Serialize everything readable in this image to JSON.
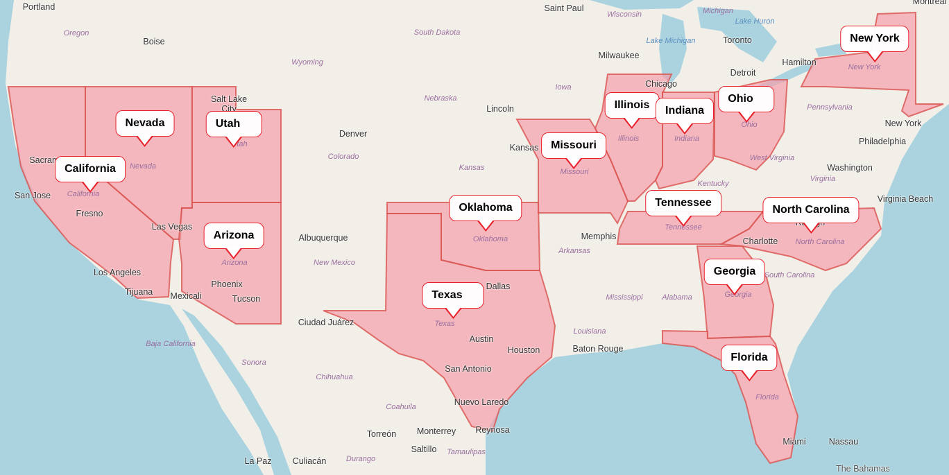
{
  "map": {
    "colors": {
      "land": "#f2efe9",
      "water": "#aad3df",
      "state_fill": "#f4a0aa",
      "state_stroke": "#d9534f",
      "marker_border": "#e8202a"
    },
    "highlighted_states": [
      {
        "name": "New York"
      },
      {
        "name": "California"
      },
      {
        "name": "Nevada"
      },
      {
        "name": "Utah"
      },
      {
        "name": "Arizona"
      },
      {
        "name": "Oklahoma"
      },
      {
        "name": "Texas"
      },
      {
        "name": "Missouri"
      },
      {
        "name": "Illinois"
      },
      {
        "name": "Indiana"
      },
      {
        "name": "Ohio"
      },
      {
        "name": "Tennessee"
      },
      {
        "name": "North Carolina"
      },
      {
        "name": "Georgia"
      },
      {
        "name": "Florida"
      }
    ],
    "cities": [
      "Portland",
      "Boise",
      "Saint Paul",
      "Milwaukee",
      "Toronto",
      "Hamilton",
      "Detroit",
      "Chicago",
      "Salt Lake City",
      "Denver",
      "Lincoln",
      "Kansas City",
      "Sacramento",
      "San Jose",
      "Fresno",
      "Las Vegas",
      "Los Angeles",
      "Tijuana",
      "Mexicali",
      "Phoenix",
      "Tucson",
      "Albuquerque",
      "Ciudad Juárez",
      "Dallas",
      "Austin",
      "Houston",
      "San Antonio",
      "Nuevo Laredo",
      "Reynosa",
      "Memphis",
      "Charlotte",
      "Baton Rouge",
      "New York",
      "Philadelphia",
      "Washington",
      "Virginia Beach",
      "Miami",
      "Nassau",
      "Torreón",
      "Monterrey",
      "Saltillo",
      "Culiacán",
      "La Paz",
      "Montreal",
      "Raleigh"
    ],
    "regions": [
      "Oregon",
      "Wyoming",
      "South Dakota",
      "Nebraska",
      "Iowa",
      "Wisconsin",
      "Michigan",
      "Colorado",
      "Kansas",
      "New Mexico",
      "Arkansas",
      "Mississippi",
      "Alabama",
      "Louisiana",
      "Kentucky",
      "West Virginia",
      "Virginia",
      "Pennsylvania",
      "South Carolina",
      "Baja California",
      "Sonora",
      "Chihuahua",
      "Coahuila",
      "Durango",
      "Tamaulipas",
      "California",
      "Nevada",
      "Utah",
      "Arizona",
      "Texas",
      "Oklahoma",
      "Missouri",
      "Illinois",
      "Indiana",
      "Ohio",
      "Tennessee",
      "North Carolina",
      "Georgia",
      "Florida",
      "New York"
    ],
    "water": [
      "Lake Michigan",
      "Lake Huron",
      "The Bahamas"
    ]
  }
}
